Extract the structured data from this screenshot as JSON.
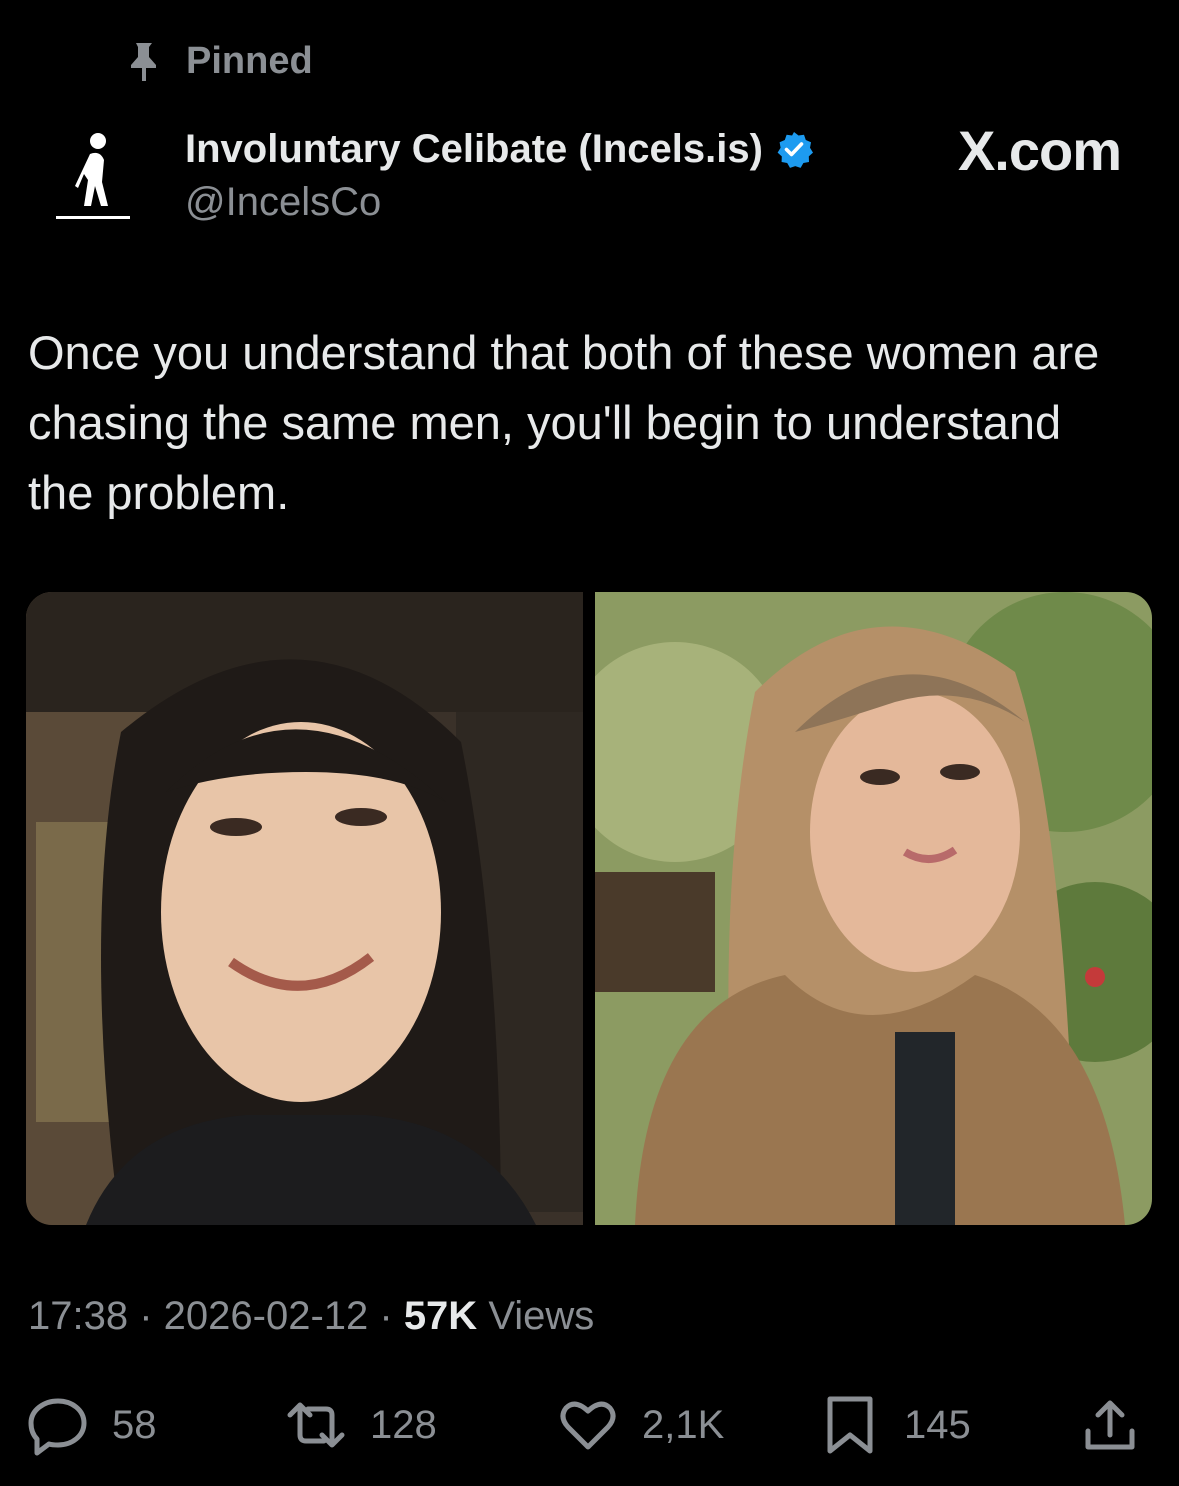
{
  "pinned_label": "Pinned",
  "author": {
    "display_name": "Involuntary Celibate (Incels.is)",
    "handle": "@IncelsCo"
  },
  "brand": "X.com",
  "tweet": {
    "text": "Once you understand that both of these women are chasing the same men, you'll begin to understand the problem."
  },
  "meta": {
    "time": "17:38",
    "sep1": " · ",
    "date": "2026-02-12",
    "sep2": " · ",
    "views_count": "57K",
    "views_label": " Views"
  },
  "actions": {
    "replies": "58",
    "reposts": "128",
    "likes": "2,1K",
    "bookmarks": "145"
  },
  "colors": {
    "background": "#000000",
    "text": "#e7e9ea",
    "muted": "#8b8f94",
    "verified": "#1d9bf0"
  }
}
